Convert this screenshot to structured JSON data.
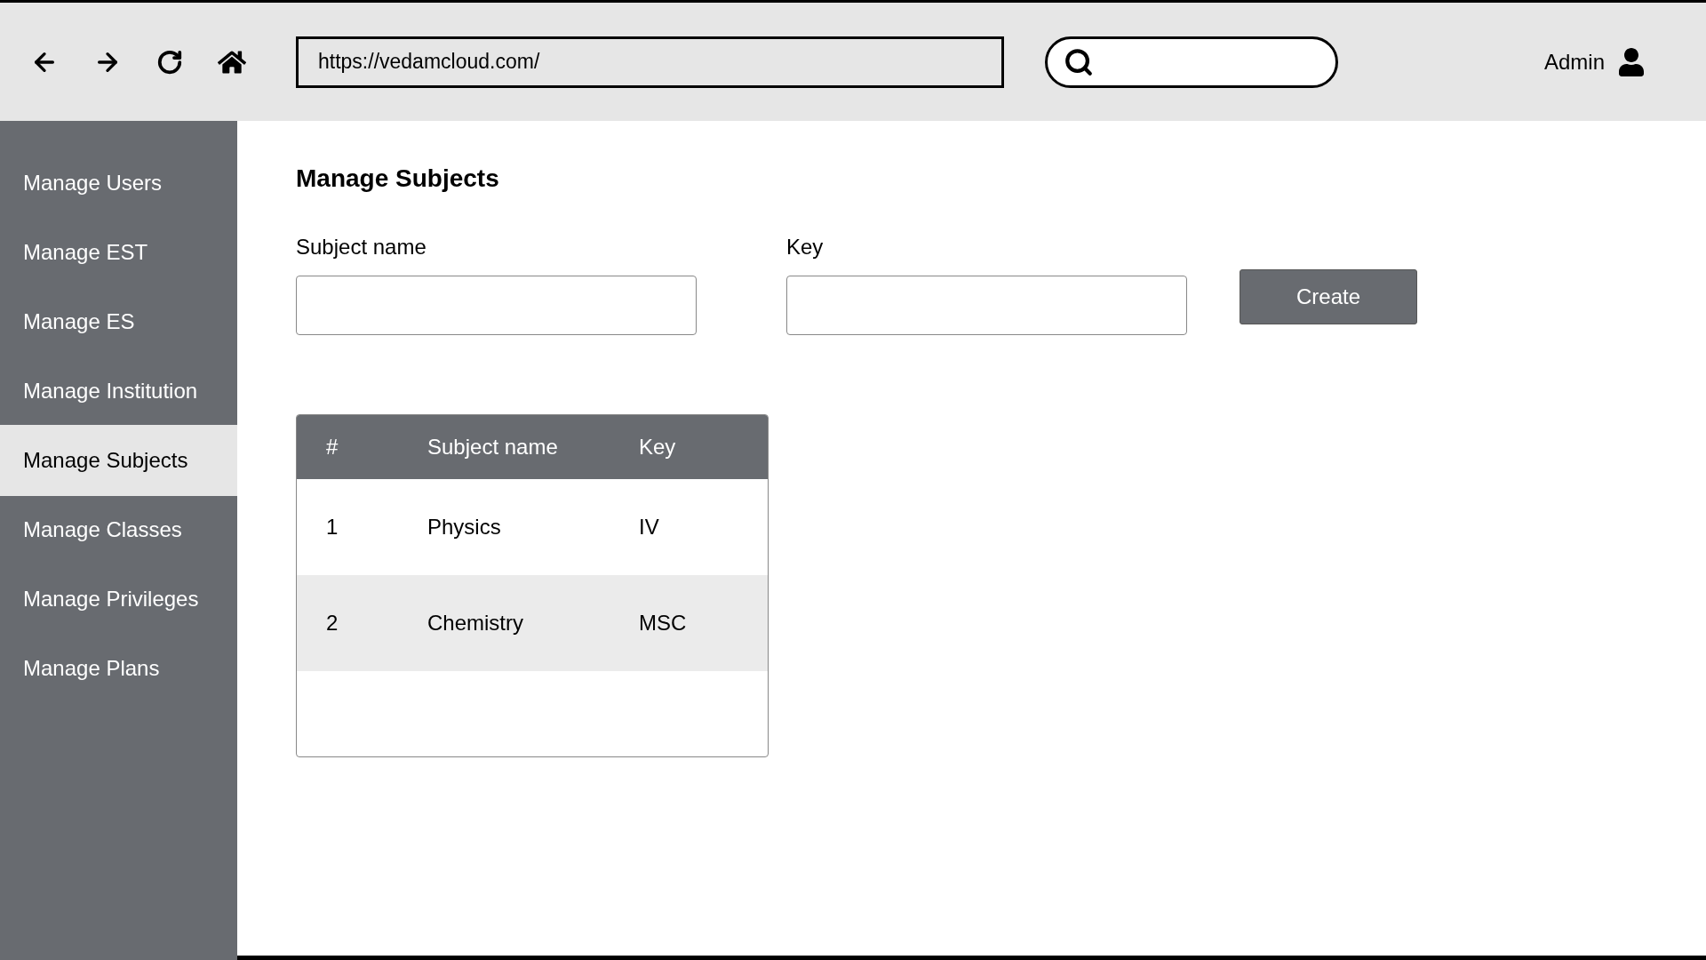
{
  "browser": {
    "url": "https://vedamcloud.com/",
    "user": "Admin"
  },
  "sidebar": {
    "items": [
      {
        "label": "Manage Users",
        "selected": false
      },
      {
        "label": "Manage EST",
        "selected": false
      },
      {
        "label": "Manage ES",
        "selected": false
      },
      {
        "label": "Manage Institution",
        "selected": false
      },
      {
        "label": "Manage Subjects",
        "selected": true
      },
      {
        "label": "Manage Classes",
        "selected": false
      },
      {
        "label": "Manage Privileges",
        "selected": false
      },
      {
        "label": "Manage Plans",
        "selected": false
      }
    ]
  },
  "page": {
    "title": "Manage Subjects",
    "form": {
      "fields": [
        {
          "label": "Subject name"
        },
        {
          "label": "Key"
        }
      ],
      "button": "Create"
    },
    "table": {
      "columns": [
        "#",
        "Subject name",
        "Key"
      ],
      "rows": [
        {
          "cells": [
            "1",
            "Physics",
            "IV"
          ],
          "selected": false
        },
        {
          "cells": [
            "2",
            "Chemistry",
            "MSC"
          ],
          "selected": true
        }
      ]
    }
  }
}
